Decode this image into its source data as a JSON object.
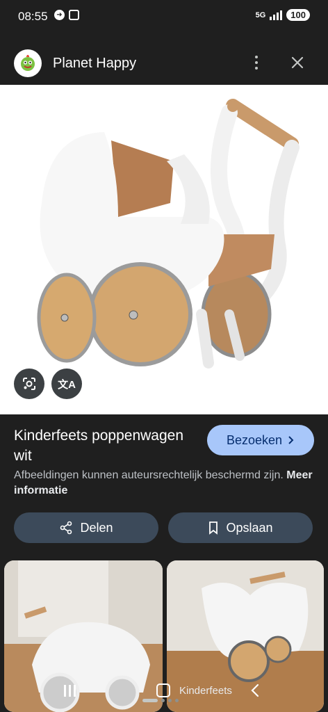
{
  "status": {
    "time": "08:55",
    "network": "5G",
    "battery": "100"
  },
  "header": {
    "site_name": "Planet Happy",
    "logo_icon": "planet-happy-logo-icon",
    "more_icon": "more-vert-icon",
    "close_icon": "close-icon"
  },
  "hero": {
    "lens_icon": "google-lens-icon",
    "translate_icon": "translate-icon",
    "translate_glyph": "文A"
  },
  "info": {
    "title": "Kinderfeets poppenwagen wit",
    "visit_label": "Bezoeken",
    "copyright_text": "Afbeeldingen kunnen auteursrechtelijk beschermd zijn.",
    "more_info_label": "Meer informatie"
  },
  "actions": {
    "share_label": "Delen",
    "save_label": "Opslaan"
  },
  "related": {
    "caption": "Kinderfeets"
  },
  "colors": {
    "accent": "#a8c7fa",
    "button_bg": "#3c4a5a",
    "background": "#1f1f1f"
  }
}
